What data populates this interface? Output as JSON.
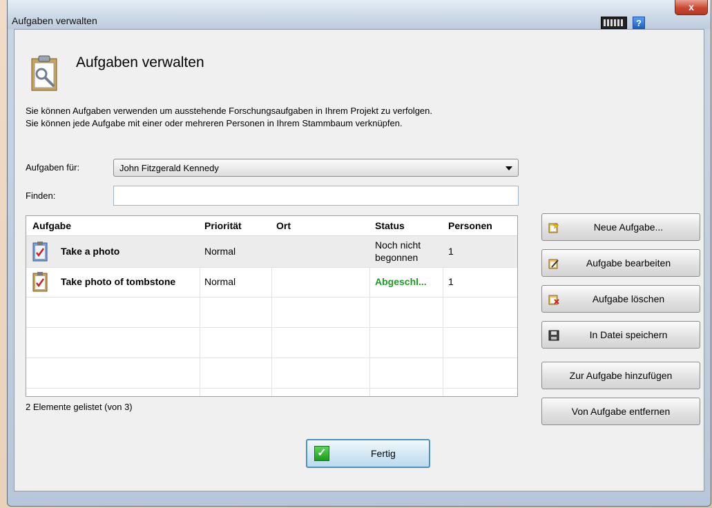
{
  "window": {
    "title": "Aufgaben verwalten",
    "close_label": "x",
    "help_label": "?"
  },
  "header": {
    "title": "Aufgaben verwalten"
  },
  "description": {
    "line1": "Sie können Aufgaben verwenden um ausstehende Forschungsaufgaben in Ihrem Projekt zu verfolgen.",
    "line2": "Sie können jede Aufgabe mit einer oder mehreren Personen in Ihrem Stammbaum verknüpfen."
  },
  "filter": {
    "label": "Aufgaben für:",
    "selected": "John Fitzgerald Kennedy",
    "find_label": "Finden:",
    "find_value": ""
  },
  "table": {
    "columns": [
      "Aufgabe",
      "Priorität",
      "Ort",
      "Status",
      "Personen"
    ],
    "rows": [
      {
        "task": "Take a photo",
        "priority": "Normal",
        "place": "",
        "status_line1": "Noch nicht",
        "status_line2": "begonnen",
        "persons": "1"
      },
      {
        "task": "Take photo of tombstone",
        "priority": "Normal",
        "place": "",
        "status_line1": "Abgeschl...",
        "status_line2": "",
        "persons": "1"
      }
    ]
  },
  "status_text": "2 Elemente gelistet (von 3)",
  "buttons": {
    "new": "Neue Aufgabe...",
    "edit": "Aufgabe bearbeiten",
    "delete": "Aufgabe löschen",
    "save": "In Datei speichern",
    "add": "Zur Aufgabe hinzufügen",
    "remove": "Von Aufgabe entfernen",
    "done": "Fertig"
  },
  "colors": {
    "complete_status": "#1f9a1f",
    "accent": "#4f8fbe"
  }
}
